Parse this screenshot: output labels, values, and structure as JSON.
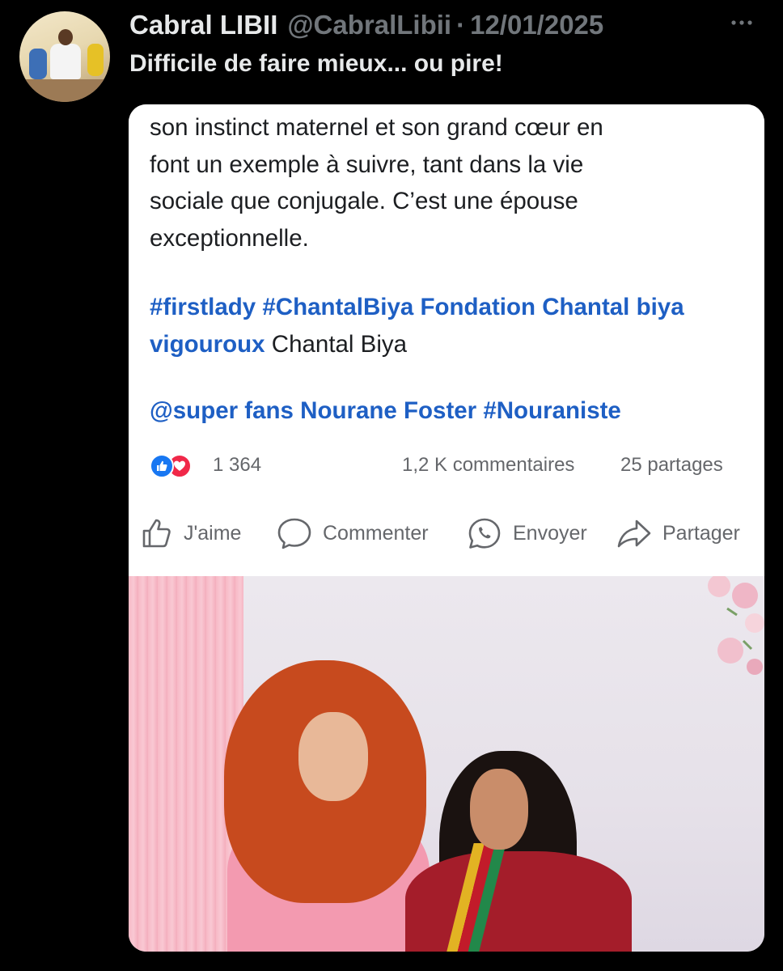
{
  "tweet": {
    "author_name": "Cabral LIBII",
    "handle": "@CabralLibii",
    "separator": "·",
    "date": "12/01/2025",
    "text": "Difficile de faire mieux... ou pire!",
    "more_icon": "more-horizontal-icon"
  },
  "fb_post": {
    "body_lines": [
      "son instinct maternel et son grand cœur en",
      "font un exemple à suivre, tant dans la vie",
      "sociale que conjugale. C’est une épouse",
      "exceptionnelle."
    ],
    "tags_line1": "#firstlady #ChantalBiya Fondation Chantal biya",
    "tags_line2_link": "vigouroux",
    "tags_line2_text": " Chantal Biya",
    "tags_line3": "@super fans Nourane Foster #Nouraniste",
    "reaction_count": "1 364",
    "comments": "1,2 K commentaires",
    "shares": "25 partages",
    "actions": {
      "like": "J'aime",
      "comment": "Commenter",
      "send": "Envoyer",
      "share": "Partager"
    },
    "colors": {
      "link": "#1e5fc4",
      "like": "#1877f2",
      "love": "#f02849"
    }
  }
}
